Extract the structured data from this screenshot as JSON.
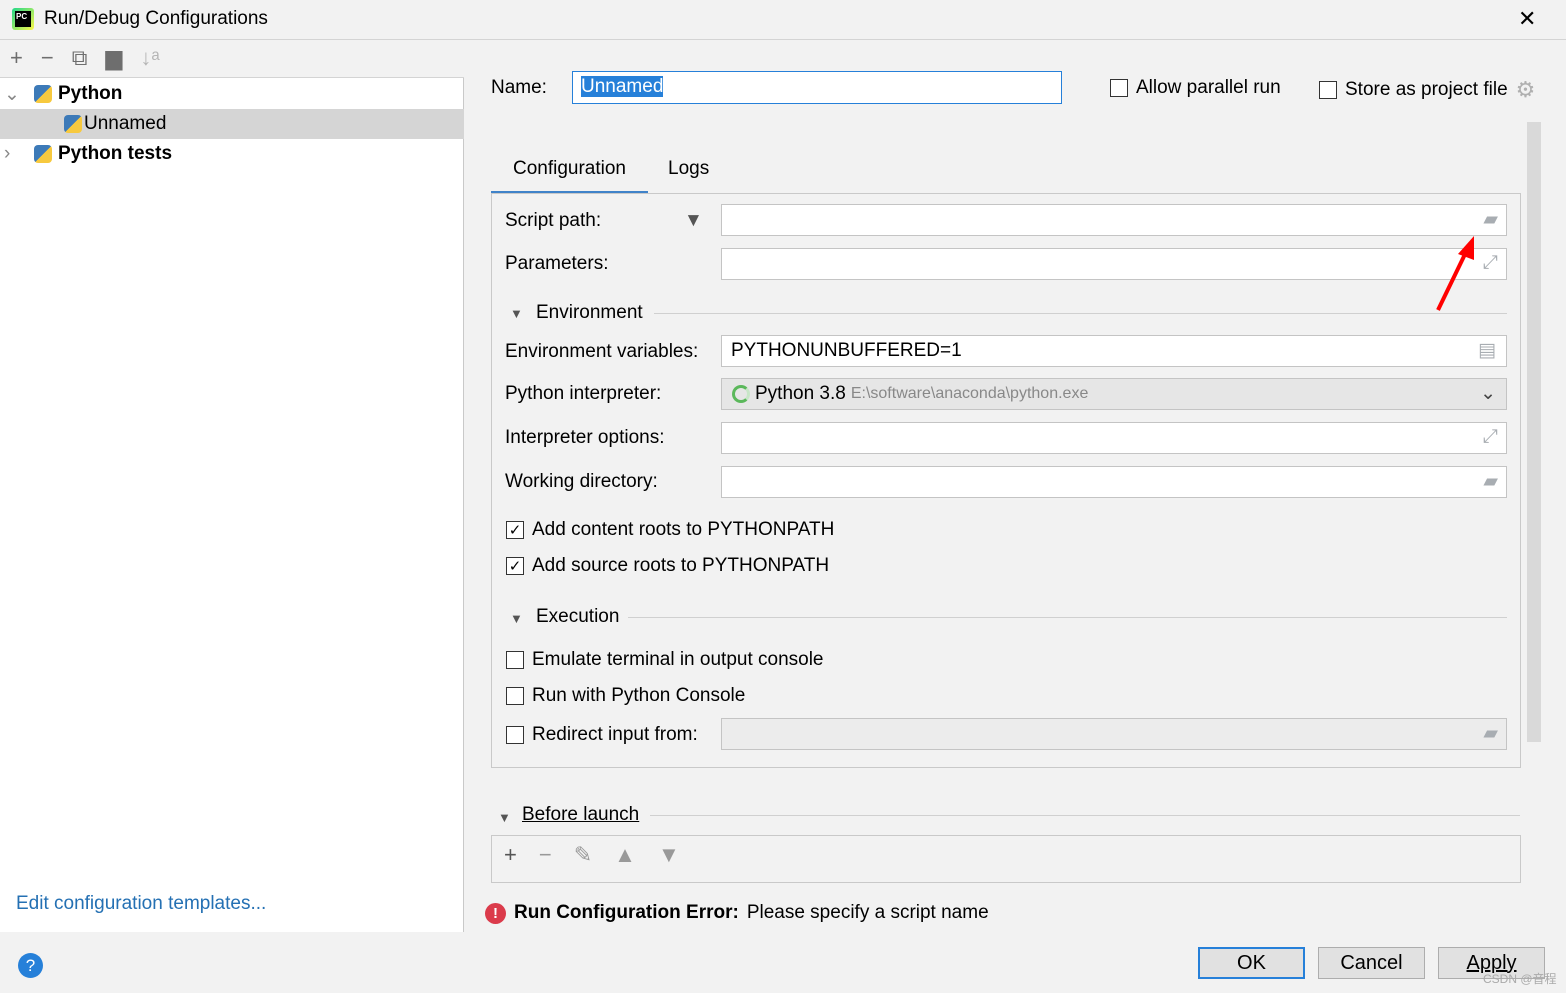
{
  "window": {
    "title": "Run/Debug Configurations",
    "close": "✕"
  },
  "left": {
    "toolbar": [
      {
        "name": "add",
        "glyph": "+"
      },
      {
        "name": "remove",
        "glyph": "−"
      },
      {
        "name": "copy",
        "glyph": "⧉"
      },
      {
        "name": "folder-add",
        "glyph": "▆"
      },
      {
        "name": "sort",
        "glyph": "↓ᵃ"
      }
    ],
    "tree": [
      {
        "label": "Python",
        "expanded": true
      },
      {
        "label": "Unnamed",
        "selected": true,
        "error": true
      },
      {
        "label": "Python tests",
        "expanded": false
      }
    ],
    "edit_templates": "Edit configuration templates..."
  },
  "header": {
    "name_label": "Name:",
    "name_value": "Unnamed",
    "allow_parallel": "Allow parallel run",
    "allow_parallel_checked": false,
    "store_project": "Store as project file",
    "store_project_checked": false
  },
  "tabs": [
    {
      "label": "Configuration",
      "active": true
    },
    {
      "label": "Logs",
      "active": false
    }
  ],
  "config": {
    "script_path": "Script path:",
    "script_value": "",
    "parameters": "Parameters:",
    "environment": "Environment",
    "env_vars": "Environment variables:",
    "env_value": "PYTHONUNBUFFERED=1",
    "interpreter": "Python interpreter:",
    "interp_name": "Python 3.8",
    "interp_path": "E:\\software\\anaconda\\python.exe",
    "interp_options": "Interpreter options:",
    "working_dir": "Working directory:",
    "content_roots": "Add content roots to PYTHONPATH",
    "content_roots_checked": true,
    "source_roots": "Add source roots to PYTHONPATH",
    "source_roots_checked": true,
    "execution": "Execution",
    "emulate": "Emulate terminal in output console",
    "emulate_checked": false,
    "python_console": "Run with Python Console",
    "python_console_checked": false,
    "redirect": "Redirect input from:",
    "redirect_checked": false
  },
  "before_launch": {
    "label": "Before launch"
  },
  "error": {
    "title": "Run Configuration Error:",
    "message": "Please specify a script name"
  },
  "buttons": {
    "ok": "OK",
    "cancel": "Cancel",
    "apply": "Apply",
    "help": "?"
  },
  "watermark": "CSDN @音程",
  "colors": {
    "accent": "#2680d9",
    "error": "#db3b4b",
    "link": "#2470b3",
    "arrow": "#ff0000"
  }
}
